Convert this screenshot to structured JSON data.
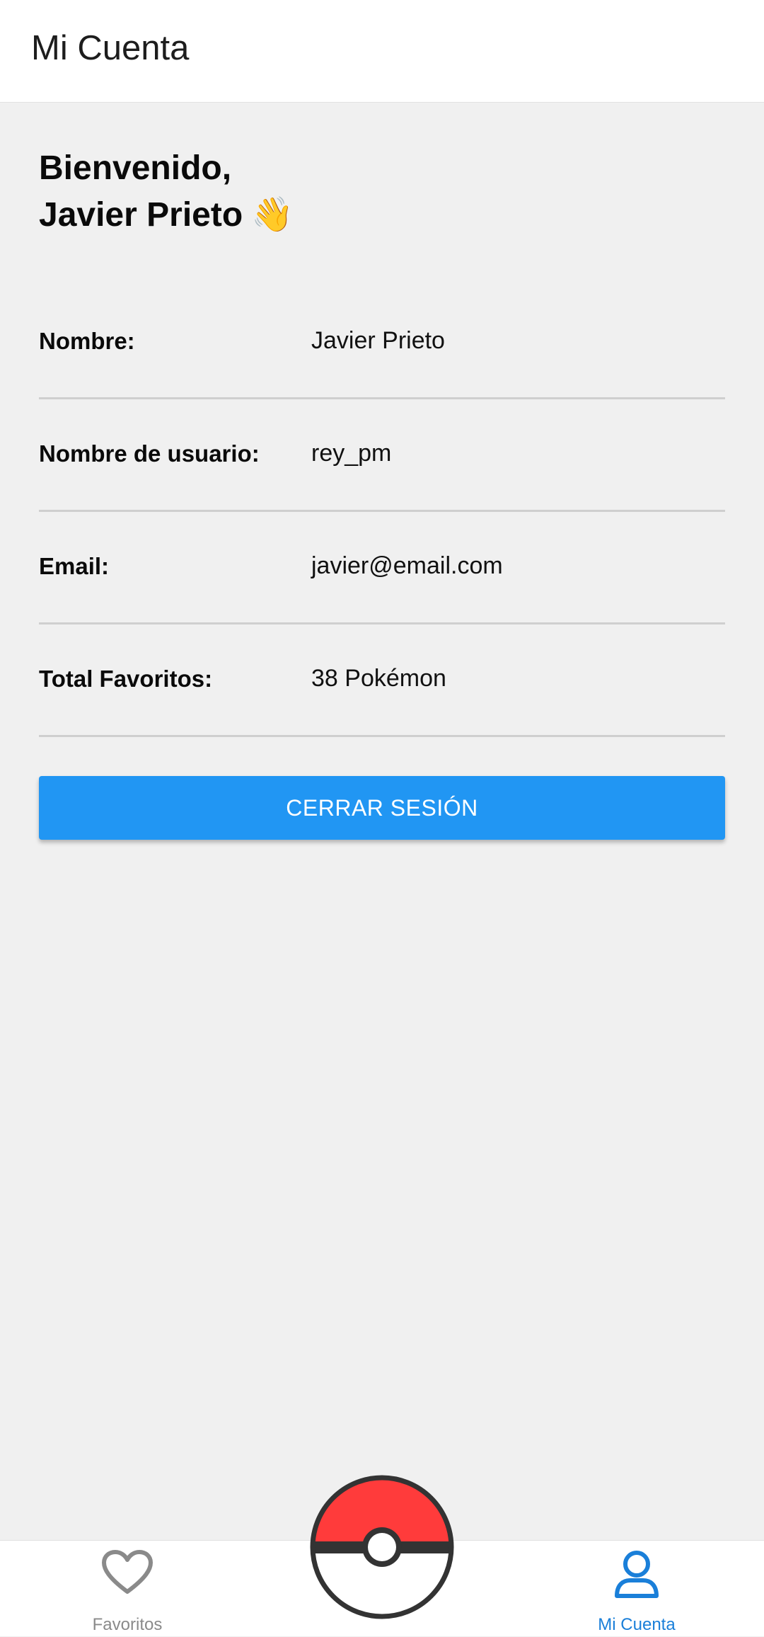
{
  "header": {
    "title": "Mi Cuenta"
  },
  "welcome": {
    "line1": "Bienvenido,",
    "line2": "Javier Prieto",
    "emoji": "👋"
  },
  "info": [
    {
      "label": "Nombre:",
      "value": "Javier Prieto"
    },
    {
      "label": "Nombre de usuario:",
      "value": "rey_pm"
    },
    {
      "label": "Email:",
      "value": "javier@email.com"
    },
    {
      "label": "Total Favoritos:",
      "value": "38 Pokémon"
    }
  ],
  "logout_button": {
    "label": "CERRAR SESIÓN"
  },
  "bottom_nav": {
    "favorites": {
      "label": "Favoritos",
      "icon": "heart-icon"
    },
    "center": {
      "icon": "pokeball-icon"
    },
    "account": {
      "label": "Mi Cuenta",
      "icon": "user-icon"
    }
  },
  "colors": {
    "accent": "#2196f3",
    "nav_active": "#1a7fd9",
    "nav_inactive": "#8a8a8a",
    "pokeball_red": "#ff3b3b",
    "background": "#f0f0f0"
  }
}
